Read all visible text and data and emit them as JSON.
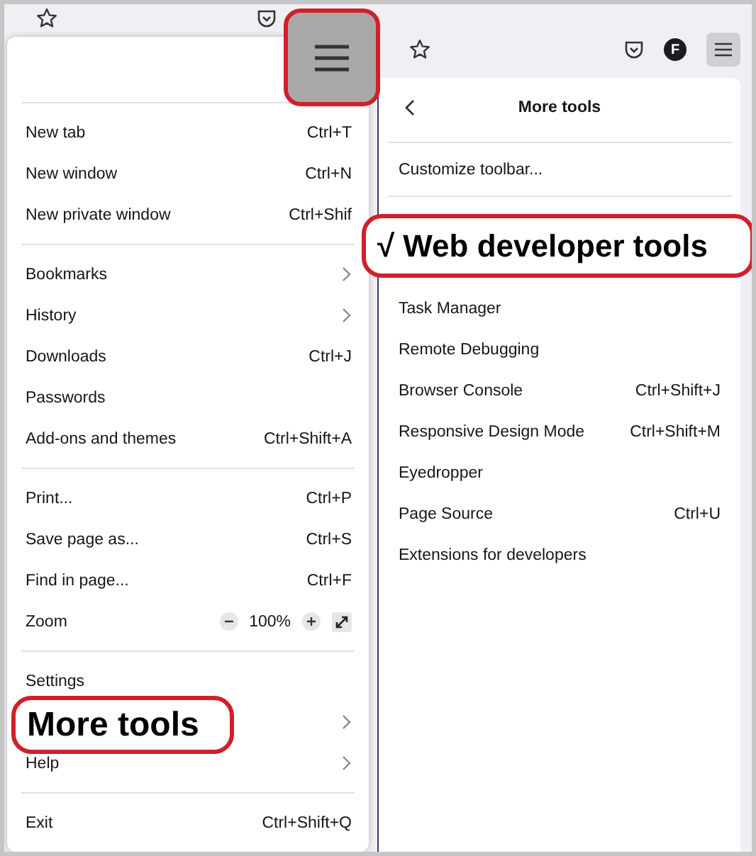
{
  "left_window": {
    "menu_sections": [
      [
        {
          "kind": "shortcut",
          "label": "New tab",
          "shortcut": "Ctrl+T"
        },
        {
          "kind": "shortcut",
          "label": "New window",
          "shortcut": "Ctrl+N"
        },
        {
          "kind": "shortcut",
          "label": "New private window",
          "shortcut": "Ctrl+Shif"
        }
      ],
      [
        {
          "kind": "submenu",
          "label": "Bookmarks"
        },
        {
          "kind": "submenu",
          "label": "History"
        },
        {
          "kind": "shortcut",
          "label": "Downloads",
          "shortcut": "Ctrl+J"
        },
        {
          "kind": "plain",
          "label": "Passwords"
        },
        {
          "kind": "shortcut",
          "label": "Add-ons and themes",
          "shortcut": "Ctrl+Shift+A"
        }
      ],
      [
        {
          "kind": "shortcut",
          "label": "Print...",
          "shortcut": "Ctrl+P"
        },
        {
          "kind": "shortcut",
          "label": "Save page as...",
          "shortcut": "Ctrl+S"
        },
        {
          "kind": "shortcut",
          "label": "Find in page...",
          "shortcut": "Ctrl+F"
        },
        {
          "kind": "zoom",
          "label": "Zoom",
          "value": "100%"
        }
      ],
      [
        {
          "kind": "plain",
          "label": "Settings"
        },
        {
          "kind": "submenu"
        },
        {
          "kind": "submenu",
          "label": "Help"
        }
      ],
      [
        {
          "kind": "shortcut",
          "label": "Exit",
          "shortcut": "Ctrl+Shift+Q"
        }
      ]
    ]
  },
  "right_window": {
    "account_initial": "F",
    "panel": {
      "title": "More tools",
      "top_items": [
        {
          "label": "Customize toolbar..."
        }
      ],
      "items": [
        {
          "kind": "plain",
          "label": "Task Manager"
        },
        {
          "kind": "plain",
          "label": "Remote Debugging"
        },
        {
          "kind": "shortcut",
          "label": "Browser Console",
          "shortcut": "Ctrl+Shift+J"
        },
        {
          "kind": "shortcut",
          "label": "Responsive Design Mode",
          "shortcut": "Ctrl+Shift+M"
        },
        {
          "kind": "plain",
          "label": "Eyedropper"
        },
        {
          "kind": "shortcut",
          "label": "Page Source",
          "shortcut": "Ctrl+U"
        },
        {
          "kind": "plain",
          "label": "Extensions for developers"
        }
      ]
    }
  },
  "annotations": [
    {
      "kind": "panel",
      "text": "√ Web developer tools"
    },
    {
      "kind": "menu",
      "text": "More tools"
    }
  ]
}
